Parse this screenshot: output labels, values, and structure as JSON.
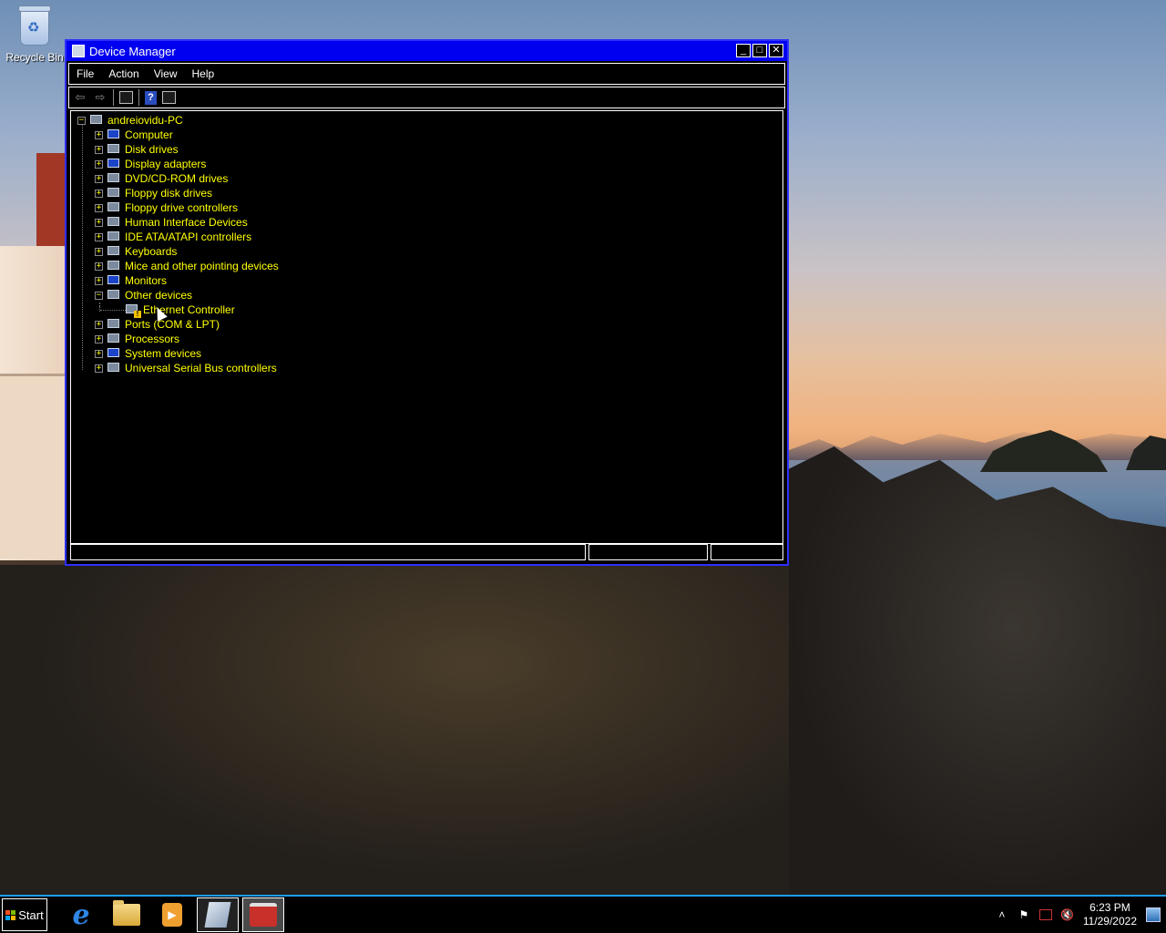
{
  "desktop": {
    "icons": [
      {
        "label": "Recycle Bin",
        "icon": "recycle-bin-icon"
      }
    ]
  },
  "window": {
    "title": "Device Manager",
    "controls": {
      "minimize": "_",
      "maximize": "□",
      "close": "✕"
    },
    "menu": [
      "File",
      "Action",
      "View",
      "Help"
    ],
    "toolbar": [
      "back-arrow-icon",
      "forward-arrow-icon",
      "properties-icon",
      "help-icon",
      "view-icon"
    ],
    "tree": {
      "root": {
        "label": "andreiovidu-PC",
        "expander": "−"
      },
      "items": [
        {
          "label": "Computer",
          "expander": "+",
          "icon": "computer-icon"
        },
        {
          "label": "Disk drives",
          "expander": "+",
          "icon": "disk-drive-icon"
        },
        {
          "label": "Display adapters",
          "expander": "+",
          "icon": "display-adapter-icon"
        },
        {
          "label": "DVD/CD-ROM drives",
          "expander": "+",
          "icon": "dvd-drive-icon"
        },
        {
          "label": "Floppy disk drives",
          "expander": "+",
          "icon": "floppy-drive-icon"
        },
        {
          "label": "Floppy drive controllers",
          "expander": "+",
          "icon": "floppy-controller-icon"
        },
        {
          "label": "Human Interface Devices",
          "expander": "+",
          "icon": "hid-icon"
        },
        {
          "label": "IDE ATA/ATAPI controllers",
          "expander": "+",
          "icon": "ide-controller-icon"
        },
        {
          "label": "Keyboards",
          "expander": "+",
          "icon": "keyboard-icon"
        },
        {
          "label": "Mice and other pointing devices",
          "expander": "+",
          "icon": "mouse-icon"
        },
        {
          "label": "Monitors",
          "expander": "+",
          "icon": "monitor-icon"
        },
        {
          "label": "Other devices",
          "expander": "−",
          "icon": "unknown-device-icon"
        },
        {
          "label": "Ethernet Controller",
          "expander": "",
          "icon": "warning-device-icon",
          "child": true
        },
        {
          "label": "Ports (COM & LPT)",
          "expander": "+",
          "icon": "port-icon"
        },
        {
          "label": "Processors",
          "expander": "+",
          "icon": "processor-icon"
        },
        {
          "label": "System devices",
          "expander": "+",
          "icon": "system-device-icon"
        },
        {
          "label": "Universal Serial Bus controllers",
          "expander": "+",
          "icon": "usb-icon"
        }
      ]
    }
  },
  "taskbar": {
    "start_label": "Start",
    "apps": [
      "internet-explorer-icon",
      "file-explorer-icon",
      "media-player-icon",
      "notepad-icon",
      "toolbox-icon"
    ],
    "tray": {
      "time": "6:23 PM",
      "date": "11/29/2022"
    }
  }
}
